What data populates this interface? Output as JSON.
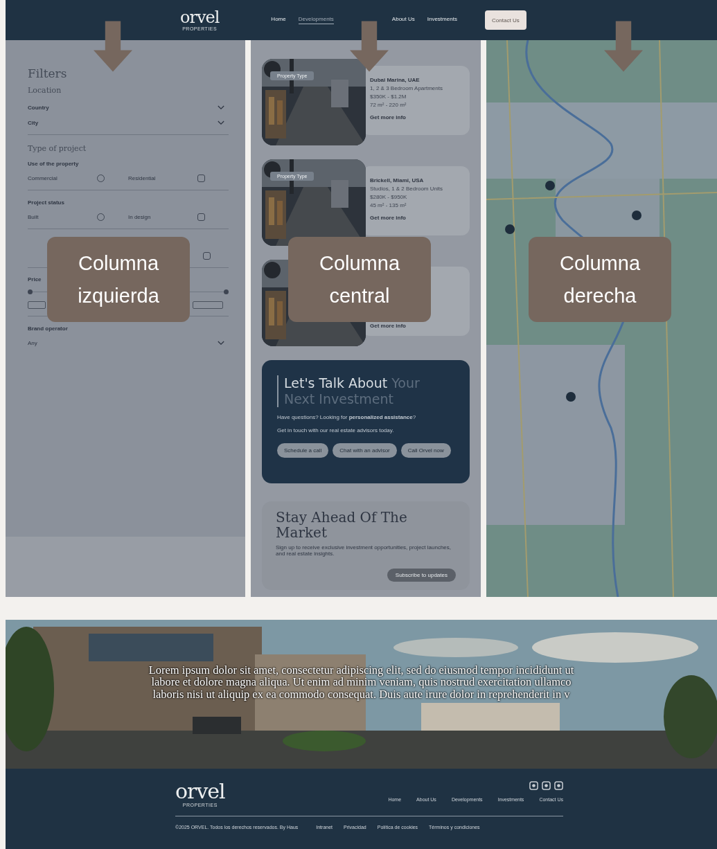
{
  "header": {
    "logo": "orvel",
    "logo_sub": "PROPERTIES",
    "nav": [
      {
        "label": "Home",
        "selected": false
      },
      {
        "label": "Developments",
        "selected": true
      },
      {
        "label": "About Us",
        "selected": false
      },
      {
        "label": "Investments",
        "selected": false
      }
    ],
    "contact_button": "Contact Us"
  },
  "filters": {
    "title": "Filters",
    "location": {
      "heading": "Location",
      "selects": [
        "Country",
        "City"
      ]
    },
    "type": {
      "heading": "Type of project",
      "groups": [
        {
          "label": "Use of the property",
          "options": [
            {
              "label": "Commercial",
              "checked": false
            },
            {
              "label": "Residential",
              "checked": false
            }
          ]
        },
        {
          "label": "Project status",
          "options": [
            {
              "label": "Built",
              "checked": false
            },
            {
              "label": "In design",
              "checked": false
            }
          ]
        },
        {
          "options": [
            {
              "checked": false
            }
          ]
        }
      ]
    },
    "price": {
      "label": "Price",
      "level": 1
    },
    "brand": {
      "label": "Brand operator",
      "value": "Any"
    }
  },
  "listings": [
    {
      "tag": "Property Type",
      "title": "Dubai Marina, UAE",
      "lines": [
        "1, 2 & 3 Bedroom Apartments",
        "$350K - $1.2M",
        "72 m² - 220 m²"
      ],
      "link": "Get more info"
    },
    {
      "tag": "Property Type",
      "title": "Brickell, Miami, USA",
      "lines": [
        "Studios, 1 & 2 Bedroom Units",
        "$280K - $950K",
        "45 m² - 135 m²"
      ],
      "link": "Get more info"
    },
    {
      "link": "Get more info"
    }
  ],
  "cta": {
    "title": "Let's Talk About ",
    "title_accent": "Your Next Investment",
    "text": "Have questions? Looking for **personalized assistance**?",
    "text2": "Get in touch with our real estate advisors today.",
    "buttons": [
      "Schedule a call",
      "Chat with an advisor",
      "Call Orvel now"
    ]
  },
  "newsletter": {
    "title": "Stay Ahead Of The Market",
    "text": "Sign up to receive exclusive investment opportunities, project launches, and real estate insights.",
    "button": "Subscribe to updates"
  },
  "banner": {
    "lines": [
      "Lorem ipsum dolor sit amet, consectetur adipiscing elit, sed do eiusmod tempor incididunt ut",
      "labore et dolore magna aliqua. Ut enim ad minim veniam, quis nostrud exercitation ullamco",
      "laboris nisi ut aliquip ex ea commodo consequat. Duis aute irure dolor in reprehenderit in v"
    ]
  },
  "footer": {
    "logo": "orvel",
    "logo_sub": "PROPERTIES",
    "links": [
      "Home",
      "About Us",
      "Developments",
      "Investments",
      "Contact Us"
    ],
    "copyright": "©2025 ORVEL. Todos los derechos reservados. By Haus",
    "legal": [
      "Intranet",
      "Privacidad",
      "Política de cookies",
      "Términos y condiciones"
    ]
  },
  "annotations": [
    "Columna izquierda",
    "Columna central",
    "Columna derecha"
  ]
}
